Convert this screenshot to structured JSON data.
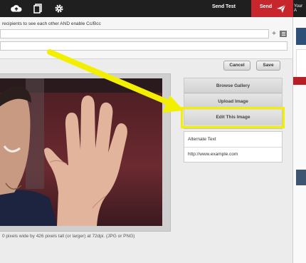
{
  "topbar": {
    "icons": [
      "cloud-upload-icon",
      "copy-icon",
      "gear-icon"
    ],
    "send_test_label": "Send Test",
    "send_label": "Send",
    "send_icon": "paper-plane-icon",
    "right_text": "Your A"
  },
  "compose": {
    "recipients_note": "recipients to see each other AND enable Cc/Bcc",
    "plus_label": "+"
  },
  "editor": {
    "cancel_label": "Cancel",
    "save_label": "Save",
    "browse_gallery_label": "Browse Gallery",
    "upload_image_label": "Upload Image",
    "edit_image_label": "Edit This Image",
    "alt_text_label": "Alternate Text",
    "link_value": "http://www.example.com",
    "image_hint": "0 pixels wide by 426 pixels tall (or larger) at 72dpi. (JPG or PNG)"
  },
  "colors": {
    "topbar": "#1f1f1f",
    "send_red": "#c8262d",
    "highlight_yellow": "#f2f000"
  }
}
